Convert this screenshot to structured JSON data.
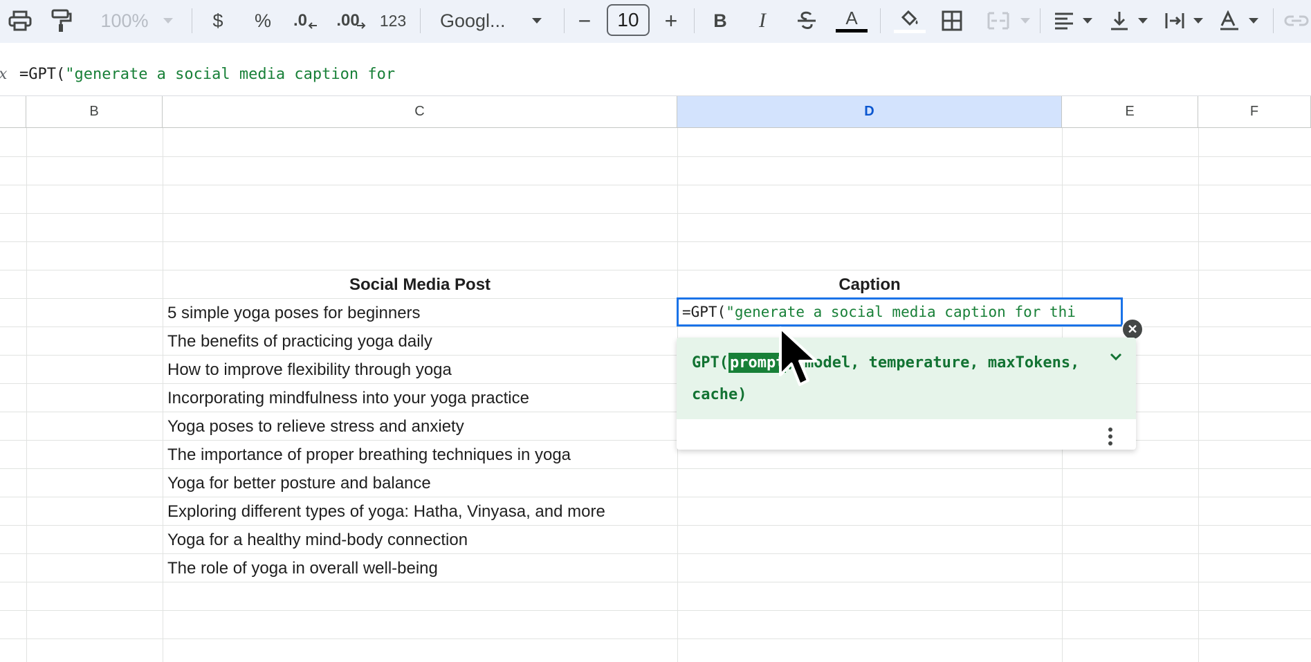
{
  "toolbar": {
    "zoom": "100%",
    "currency": "$",
    "percent": "%",
    "decrease_decimal": ".0",
    "increase_decimal": ".00",
    "number_format": "123",
    "font": "Googl...",
    "font_size": "10",
    "font_size_decrease": "−",
    "font_size_increase": "+",
    "bold": "B",
    "italic": "I",
    "text_color_letter": "A",
    "text_color_bar": "#000000"
  },
  "formula_bar": {
    "fx_label": "x",
    "fn_part": "=GPT(",
    "str_part": "\"generate a social media caption for"
  },
  "columns": [
    "B",
    "C",
    "D",
    "E",
    "F"
  ],
  "sheet": {
    "header_post": "Social Media Post",
    "header_caption": "Caption",
    "posts": [
      "5 simple yoga poses for beginners",
      "The benefits of practicing yoga daily",
      "How to improve flexibility through yoga",
      "Incorporating mindfulness into your yoga practice",
      "Yoga poses to relieve stress and anxiety",
      "The importance of proper breathing techniques in yoga",
      "Yoga for better posture and balance",
      "Exploring different types of yoga: Hatha, Vinyasa, and more",
      "Yoga for a healthy mind-body connection",
      "The role of yoga in overall well-being"
    ]
  },
  "editor": {
    "fn_part": "=GPT(",
    "str_part": "\"generate a social media caption for thi"
  },
  "autocomplete": {
    "fn_name": "GPT(",
    "active_arg": "prompt",
    "rest_args": ", model, temperature, maxTokens,",
    "last_line": "cache)"
  },
  "colors": {
    "accent": "#1a73e8",
    "selected_header": "#d3e3fd",
    "formula_string": "#188038",
    "popup_bg": "#e6f4ea"
  }
}
